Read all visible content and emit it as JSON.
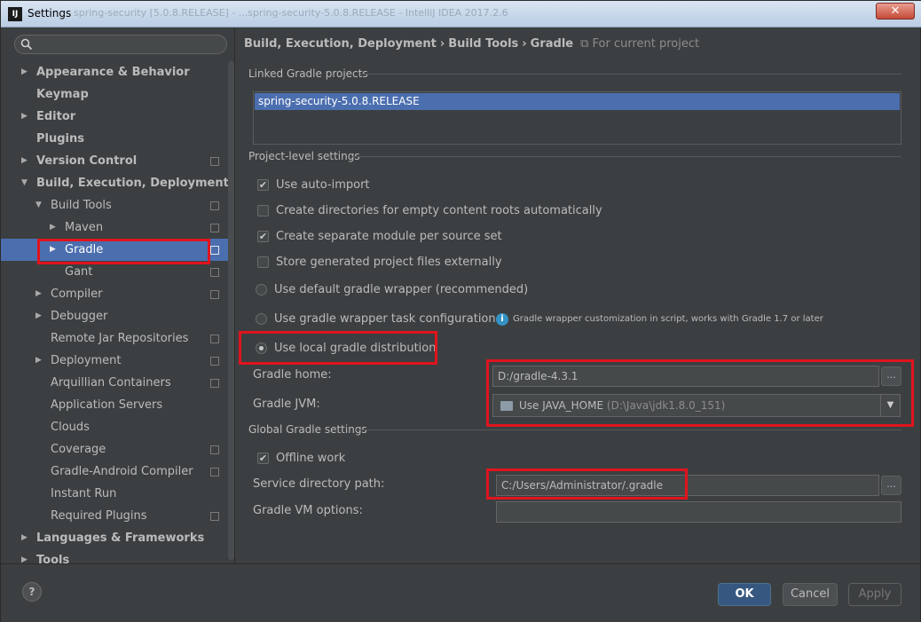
{
  "window": {
    "title": "Settings",
    "title_ghost": "spring-security [5.0.8.RELEASE] - ...spring-security-5.0.8.RELEASE - IntelliJ IDEA 2017.2.6",
    "close_glyph": "✕"
  },
  "sidebar": {
    "search_placeholder": "",
    "items": [
      {
        "label": "Appearance & Behavior",
        "arrow": "▶",
        "bold": true
      },
      {
        "label": "Keymap",
        "bold": true
      },
      {
        "label": "Editor",
        "arrow": "▶",
        "bold": true
      },
      {
        "label": "Plugins",
        "bold": true
      },
      {
        "label": "Version Control",
        "arrow": "▶",
        "bold": true
      },
      {
        "label": "Build, Execution, Deployment",
        "arrow": "▼",
        "bold": true
      },
      {
        "label": "Build Tools",
        "arrow": "▼"
      },
      {
        "label": "Maven",
        "arrow": "▶"
      },
      {
        "label": "Gradle",
        "arrow": "▶"
      },
      {
        "label": "Gant"
      },
      {
        "label": "Compiler",
        "arrow": "▶"
      },
      {
        "label": "Debugger",
        "arrow": "▶"
      },
      {
        "label": "Remote Jar Repositories"
      },
      {
        "label": "Deployment",
        "arrow": "▶"
      },
      {
        "label": "Arquillian Containers"
      },
      {
        "label": "Application Servers"
      },
      {
        "label": "Clouds"
      },
      {
        "label": "Coverage"
      },
      {
        "label": "Gradle-Android Compiler"
      },
      {
        "label": "Instant Run"
      },
      {
        "label": "Required Plugins"
      },
      {
        "label": "Languages & Frameworks",
        "arrow": "▶",
        "bold": true
      },
      {
        "label": "Tools",
        "arrow": "▶",
        "bold": true
      }
    ]
  },
  "breadcrumb": {
    "part1": "Build, Execution, Deployment",
    "part2": "Build Tools",
    "part3": "Gradle",
    "sep": "›",
    "scope": "For current project"
  },
  "linked_projects": {
    "title": "Linked Gradle projects",
    "items": [
      "spring-security-5.0.8.RELEASE"
    ]
  },
  "project_settings": {
    "title": "Project-level settings",
    "use_auto_import": "Use auto-import",
    "create_dirs": "Create directories for empty content roots automatically",
    "separate_module": "Create separate module per source set",
    "store_external": "Store generated project files externally",
    "default_wrapper": "Use default gradle wrapper (recommended)",
    "wrapper_task": "Use gradle wrapper task configuration",
    "wrapper_info": "Gradle wrapper customization in script, works with Gradle 1.7 or later",
    "local_distribution": "Use local gradle distribution",
    "gradle_home_label": "Gradle home:",
    "gradle_home_value": "D:/gradle-4.3.1",
    "gradle_jvm_label": "Gradle JVM:",
    "gradle_jvm_value": "Use JAVA_HOME",
    "gradle_jvm_path": "(D:\\Java\\jdk1.8.0_151)"
  },
  "global_settings": {
    "title": "Global Gradle settings",
    "offline_work": "Offline work",
    "service_dir_label": "Service directory path:",
    "service_dir_value": "C:/Users/Administrator/.gradle",
    "vm_options_label": "Gradle VM options:",
    "vm_options_value": ""
  },
  "buttons": {
    "browse": "...",
    "help": "?",
    "ok": "OK",
    "cancel": "Cancel",
    "apply": "Apply"
  },
  "colors": {
    "selection": "#4b6eaf",
    "highlight_box": "#e0141e",
    "background": "#3c3f41"
  }
}
